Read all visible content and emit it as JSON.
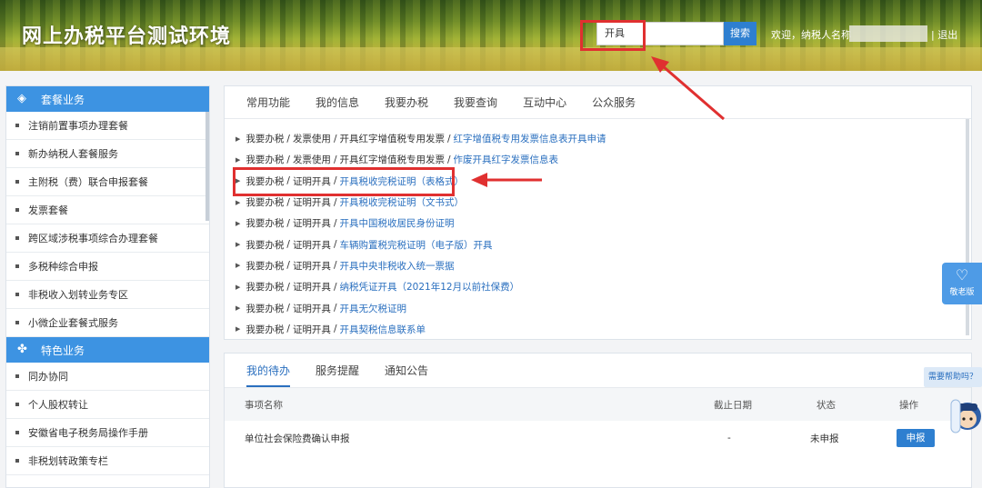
{
  "header": {
    "site_title": "网上办税平台测试环境",
    "search_value": "开具",
    "search_button": "搜索",
    "welcome_text": "欢迎，纳税人名称",
    "logout": "退出"
  },
  "sidebar": {
    "section1_title": "套餐业务",
    "section1_items": [
      "注销前置事项办理套餐",
      "新办纳税人套餐服务",
      "主附税（费）联合申报套餐",
      "发票套餐",
      "跨区域涉税事项综合办理套餐",
      "多税种综合申报",
      "非税收入划转业务专区",
      "小微企业套餐式服务"
    ],
    "section2_title": "特色业务",
    "section2_items": [
      "同办协同",
      "个人股权转让",
      "安徽省电子税务局操作手册",
      "非税划转政策专栏"
    ]
  },
  "top_tabs": [
    "常用功能",
    "我的信息",
    "我要办税",
    "我要查询",
    "互动中心",
    "公众服务"
  ],
  "links": [
    {
      "path": [
        "我要办税",
        "发票使用",
        "开具红字增值税专用发票"
      ],
      "leaf": "红字增值税专用发票信息表开具申请"
    },
    {
      "path": [
        "我要办税",
        "发票使用",
        "开具红字增值税专用发票"
      ],
      "leaf": "作废开具红字发票信息表"
    },
    {
      "path": [
        "我要办税",
        "证明开具"
      ],
      "leaf": "开具税收完税证明（表格式）"
    },
    {
      "path": [
        "我要办税",
        "证明开具"
      ],
      "leaf": "开具税收完税证明（文书式）"
    },
    {
      "path": [
        "我要办税",
        "证明开具"
      ],
      "leaf": "开具中国税收居民身份证明"
    },
    {
      "path": [
        "我要办税",
        "证明开具"
      ],
      "leaf": "车辆购置税完税证明（电子版）开具"
    },
    {
      "path": [
        "我要办税",
        "证明开具"
      ],
      "leaf": "开具中央非税收入统一票据"
    },
    {
      "path": [
        "我要办税",
        "证明开具"
      ],
      "leaf": "纳税凭证开具（2021年12月以前社保费）"
    },
    {
      "path": [
        "我要办税",
        "证明开具"
      ],
      "leaf": "开具无欠税证明"
    },
    {
      "path": [
        "我要办税",
        "证明开具"
      ],
      "leaf": "开具契税信息联系单"
    }
  ],
  "bottom_tabs": [
    "我的待办",
    "服务提醒",
    "通知公告"
  ],
  "table": {
    "headers": [
      "事项名称",
      "截止日期",
      "状态",
      "操作"
    ],
    "rows": [
      {
        "name": "单位社会保险费确认申报",
        "deadline": "-",
        "status": "未申报",
        "action": "申报"
      }
    ]
  },
  "widgets": {
    "elder_mode": "敬老版",
    "help": "需要帮助吗？"
  },
  "colors": {
    "accent": "#2e7fd0",
    "annotation": "#e03030"
  }
}
